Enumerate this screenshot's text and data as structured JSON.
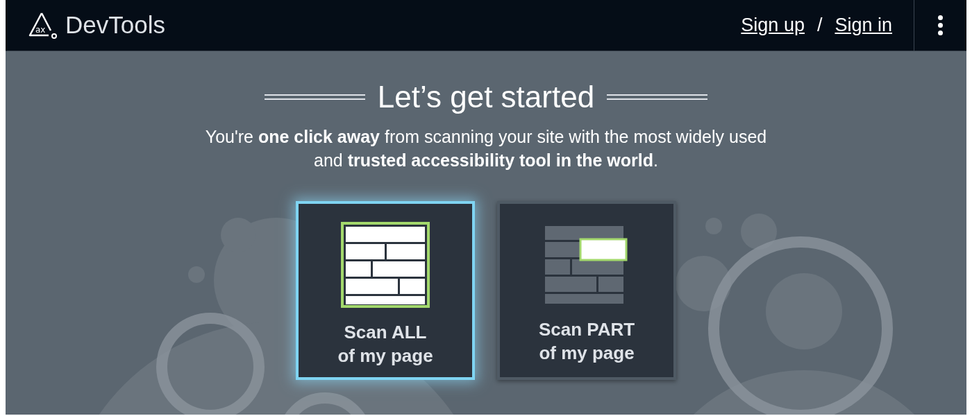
{
  "header": {
    "logo_mark": "ax",
    "title": "DevTools",
    "links": [
      {
        "label": "Sign up"
      },
      {
        "label": "Sign in"
      }
    ],
    "separator": "/"
  },
  "heading": "Let’s get started",
  "intro": "You're **one click away** from scanning your site with the most widely used and **trusted accessibility tool in the world**.",
  "options": [
    {
      "kind": "all",
      "line1": "Scan ALL",
      "line2": "of my page",
      "selected": true
    },
    {
      "kind": "part",
      "line1": "Scan PART",
      "line2": "of my page",
      "selected": false
    }
  ]
}
